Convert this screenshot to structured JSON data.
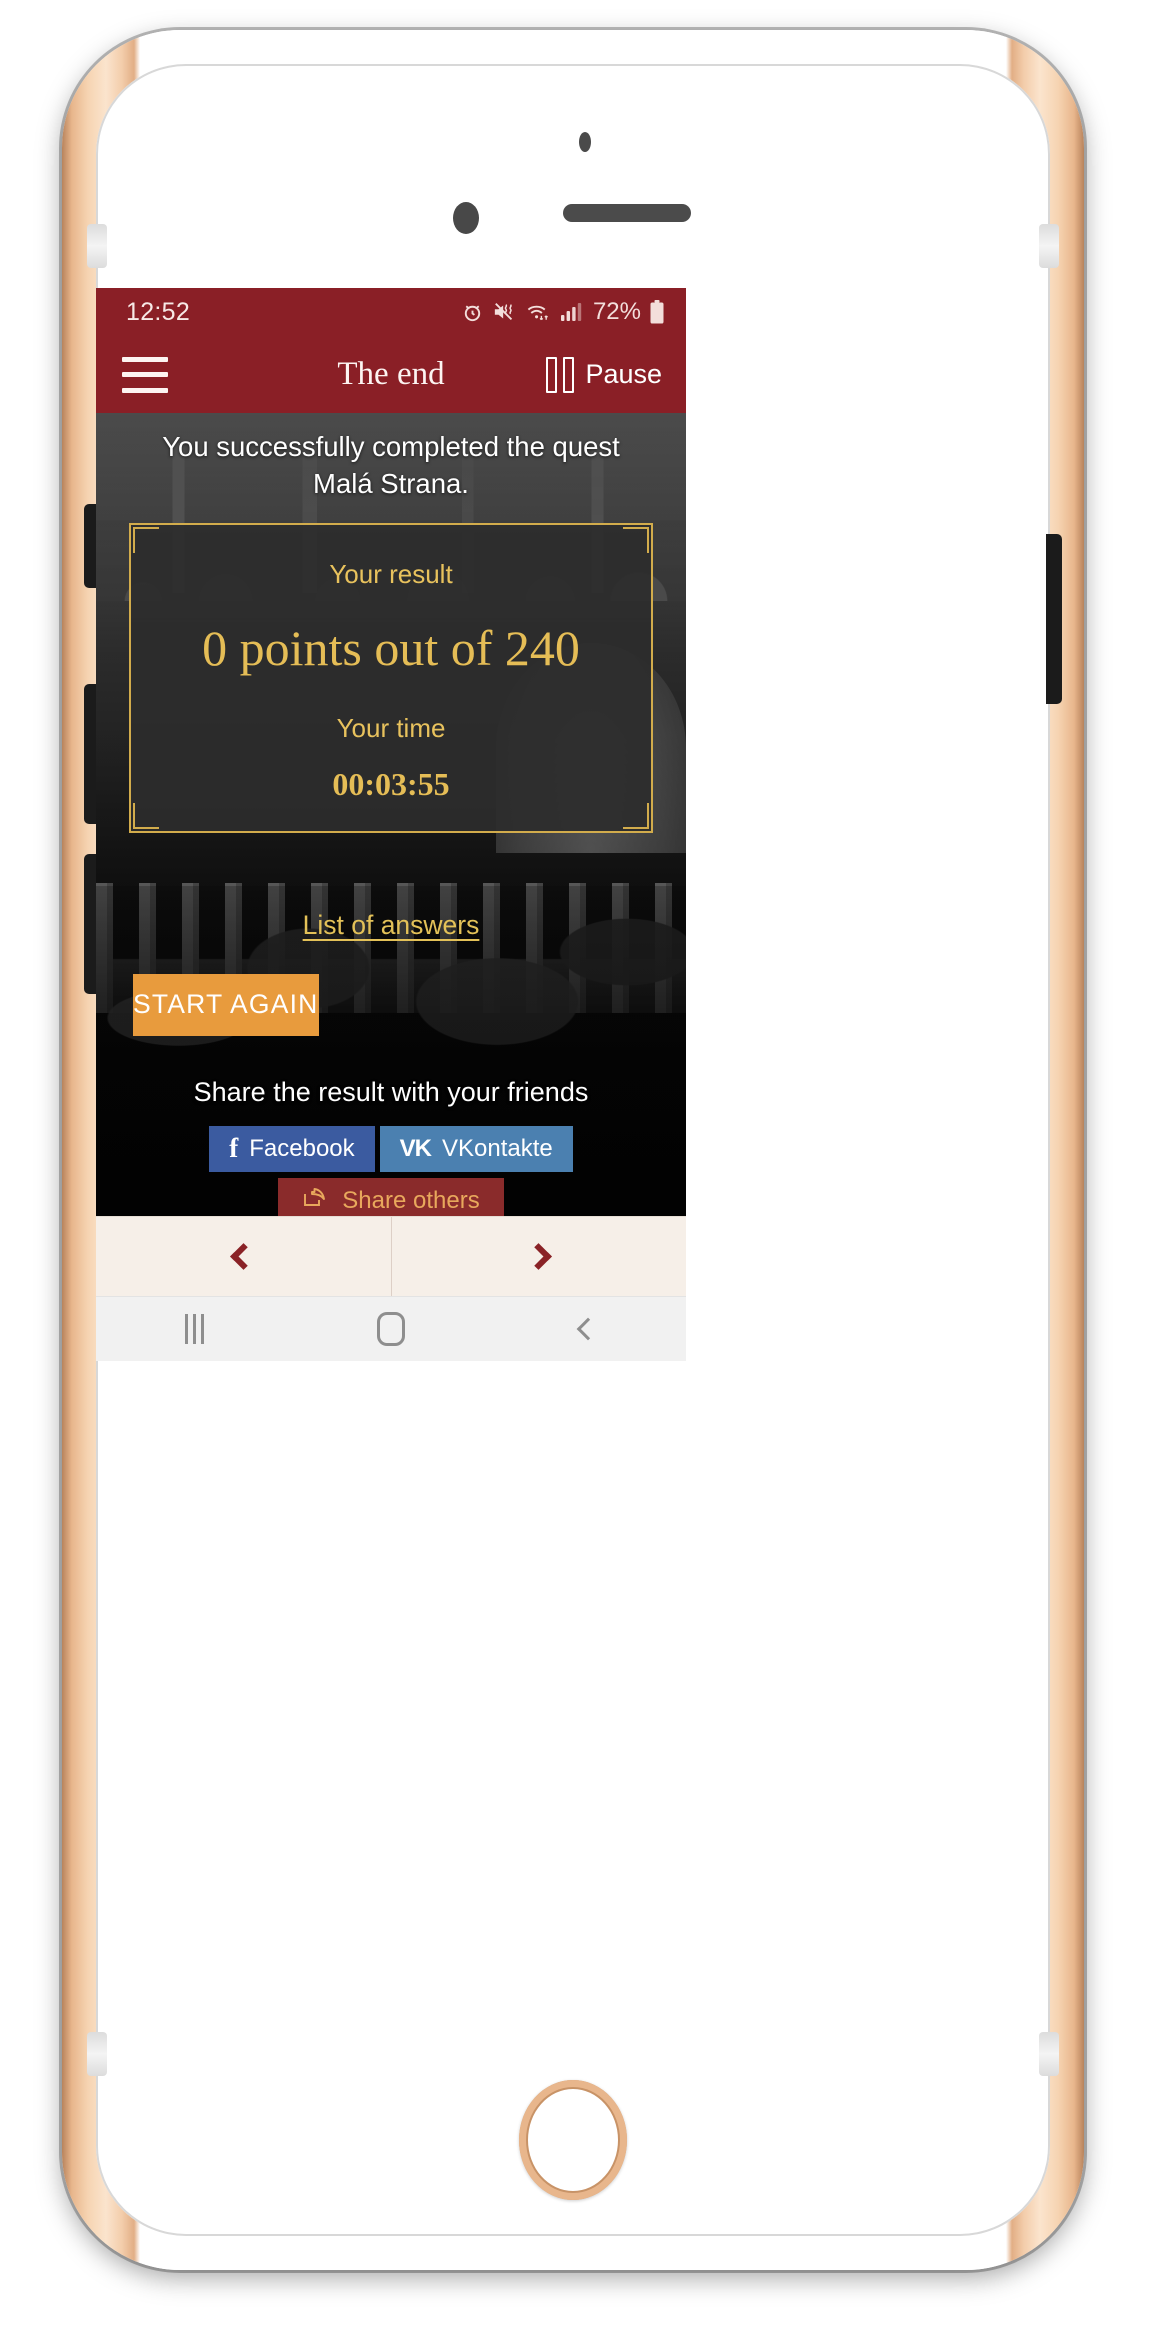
{
  "device": {
    "frame_color": "#e8b68c",
    "hardware": {
      "earpiece": "earpiece-speaker",
      "front_camera": "front-camera",
      "proximity_sensor": "proximity-sensor",
      "home_button": "home-button",
      "mute_switch": "mute-switch",
      "volume_up": "volume-up-button",
      "volume_down": "volume-down-button",
      "power": "power-button"
    }
  },
  "status_bar": {
    "time": "12:52",
    "battery_percent": "72%",
    "background": "#8a1f26",
    "icons": [
      "alarm-icon",
      "mute-vibrate-icon",
      "wifi-icon",
      "signal-icon",
      "battery-icon"
    ]
  },
  "app_bar": {
    "menu_label": "menu",
    "title": "The end",
    "pause_label": "Pause",
    "background": "#8a1f26"
  },
  "main": {
    "completion_text": "You successfully completed the quest Malá Strana.",
    "result_card": {
      "result_label": "Your result",
      "result_value": "0 points out of 240",
      "points_scored": "0",
      "points_total": "240",
      "time_label": "Your time",
      "time_value": "00:03:55",
      "border_color": "#d2ac4c",
      "text_color": "#e5bd56"
    },
    "answers_link": "List of answers",
    "start_again_label": "START AGAIN",
    "start_again_color": "#e89b3d",
    "share": {
      "title": "Share the result with your friends",
      "buttons": [
        {
          "label": "Facebook",
          "icon": "facebook-icon",
          "color": "#3b5ba0"
        },
        {
          "label": "VKontakte",
          "icon": "vkontakte-icon",
          "color": "#4b80b0"
        },
        {
          "label": "Share others",
          "icon": "share-icon",
          "color": "#8a2b2b"
        }
      ]
    }
  },
  "quest_nav": {
    "prev": "prev-chevron",
    "next": "next-chevron",
    "background": "#f6efe8"
  },
  "system_nav": {
    "recents": "recents-icon",
    "home": "home-icon",
    "back": "back-icon"
  }
}
